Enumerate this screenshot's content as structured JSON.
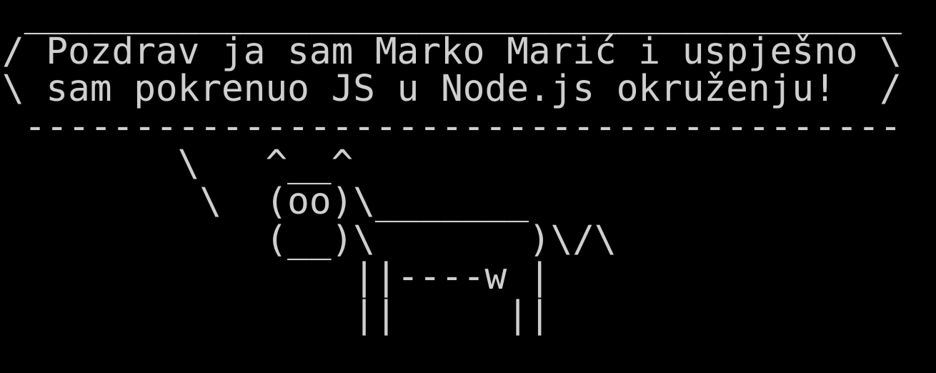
{
  "terminal": {
    "background_color": "#000000",
    "text_color": "#cfcfcf",
    "lines": [
      " ________________________________________",
      "/ Pozdrav ja sam Marko Marić i uspješno \\",
      "\\ sam pokrenuo JS u Node.js okruženju!  /",
      " ----------------------------------------",
      "        \\   ^__^",
      "         \\  (oo)\\_______",
      "            (__)\\       )\\/\\",
      "                ||----w |",
      "                ||     ||"
    ]
  }
}
